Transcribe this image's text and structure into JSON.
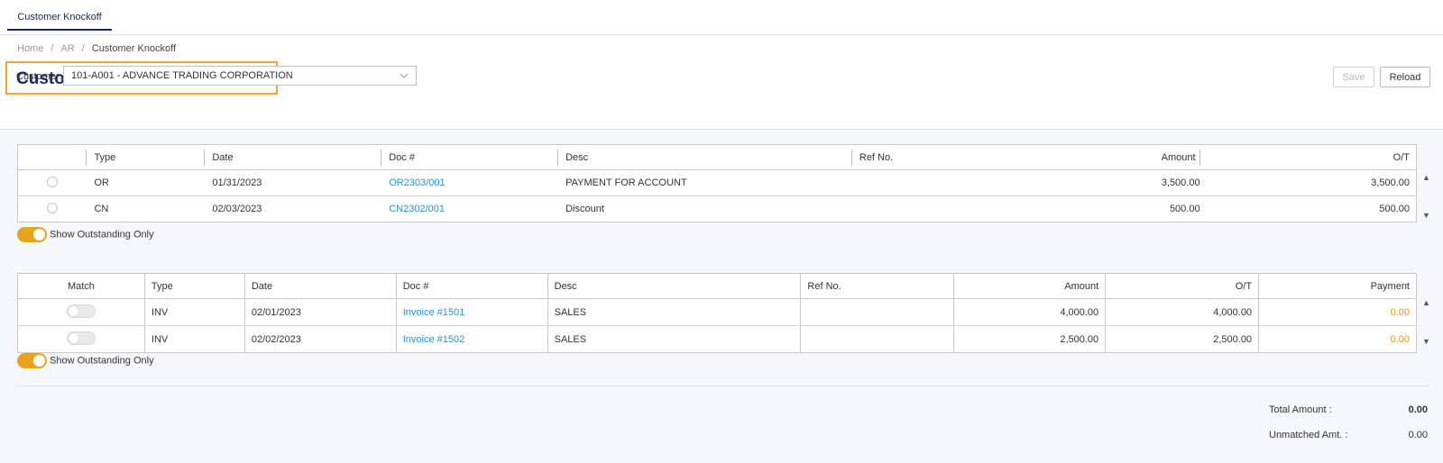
{
  "tabs": [
    {
      "label": "Customer Knockoff"
    }
  ],
  "breadcrumb": [
    "Home",
    "AR",
    "Customer Knockoff"
  ],
  "breadcrumb_sep": "/",
  "page_title": "Customer Knockoff",
  "toolbar": {
    "save_label": "Save",
    "reload_label": "Reload"
  },
  "customer": {
    "label": "Customer:",
    "value": "101-A001 - ADVANCE TRADING CORPORATION"
  },
  "payments_table": {
    "headers": [
      "Type",
      "Date",
      "Doc #",
      "Desc",
      "Ref No.",
      "Amount",
      "O/T"
    ],
    "rows": [
      {
        "type": "OR",
        "date": "01/31/2023",
        "doc": "OR2303/001",
        "desc": "PAYMENT FOR ACCOUNT",
        "ref": "",
        "amount": "3,500.00",
        "ot": "3,500.00"
      },
      {
        "type": "CN",
        "date": "02/03/2023",
        "doc": "CN2302/001",
        "desc": "Discount",
        "ref": "",
        "amount": "500.00",
        "ot": "500.00"
      }
    ],
    "toggle_label": "Show Outstanding Only"
  },
  "invoices_table": {
    "headers": [
      "Match",
      "Type",
      "Date",
      "Doc #",
      "Desc",
      "Ref No.",
      "Amount",
      "O/T",
      "Payment"
    ],
    "rows": [
      {
        "type": "INV",
        "date": "02/01/2023",
        "doc": "Invoice #1501",
        "desc": "SALES",
        "ref": "",
        "amount": "4,000.00",
        "ot": "4,000.00",
        "payment": "0.00"
      },
      {
        "type": "INV",
        "date": "02/02/2023",
        "doc": "Invoice #1502",
        "desc": "SALES",
        "ref": "",
        "amount": "2,500.00",
        "ot": "2,500.00",
        "payment": "0.00"
      }
    ],
    "toggle_label": "Show Outstanding Only"
  },
  "totals": {
    "total_amount_label": "Total Amount :",
    "total_amount": "0.00",
    "unmatched_label": "Unmatched Amt. :",
    "unmatched": "0.00"
  },
  "colors": {
    "title": "#1b2a5e",
    "link": "#2a8fd9",
    "accent": "#e8a31f",
    "highlight_box": "#f0a534"
  }
}
